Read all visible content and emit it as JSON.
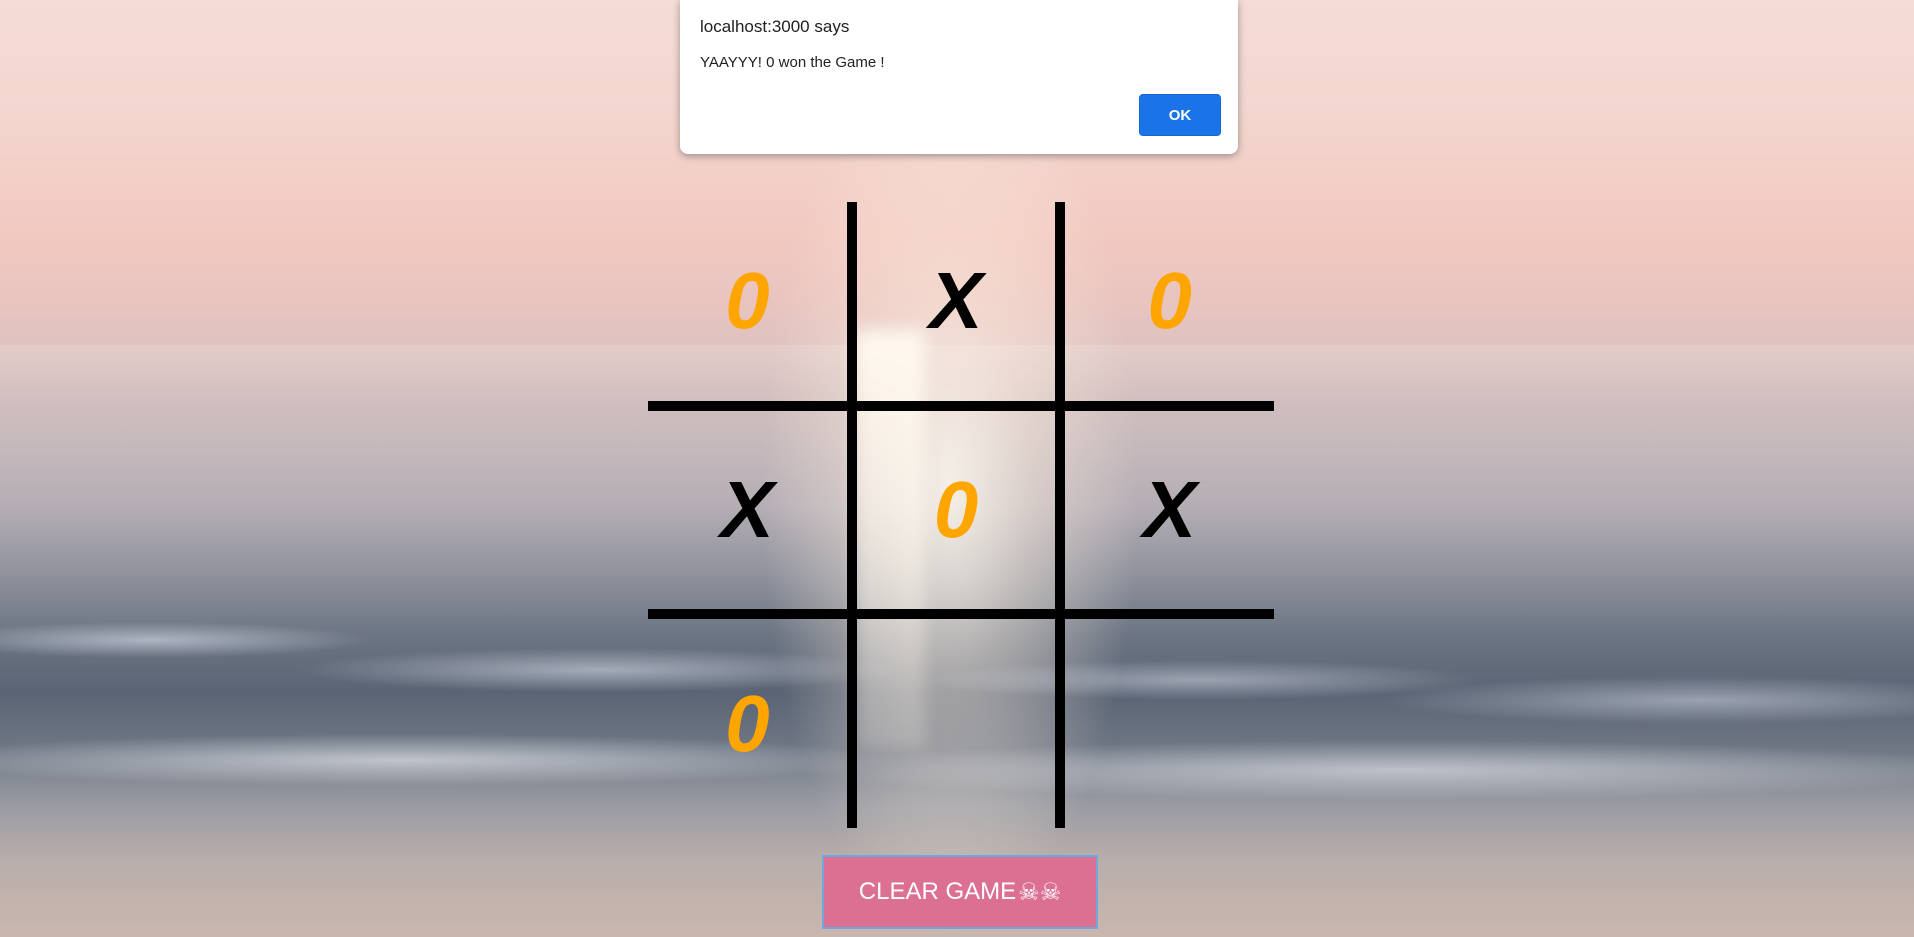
{
  "dialog": {
    "title": "localhost:3000 says",
    "message": "YAAYYY! 0 won the Game !",
    "ok_label": "OK"
  },
  "board": {
    "cells": [
      "0",
      "X",
      "0",
      "X",
      "0",
      "X",
      "0",
      "",
      ""
    ]
  },
  "controls": {
    "clear_label": "CLEAR GAME",
    "clear_icons": "☠☠"
  },
  "colors": {
    "x_mark": "#000000",
    "o_mark": "#ffa500",
    "clear_button": "#db7093",
    "ok_button": "#1a73e8"
  }
}
